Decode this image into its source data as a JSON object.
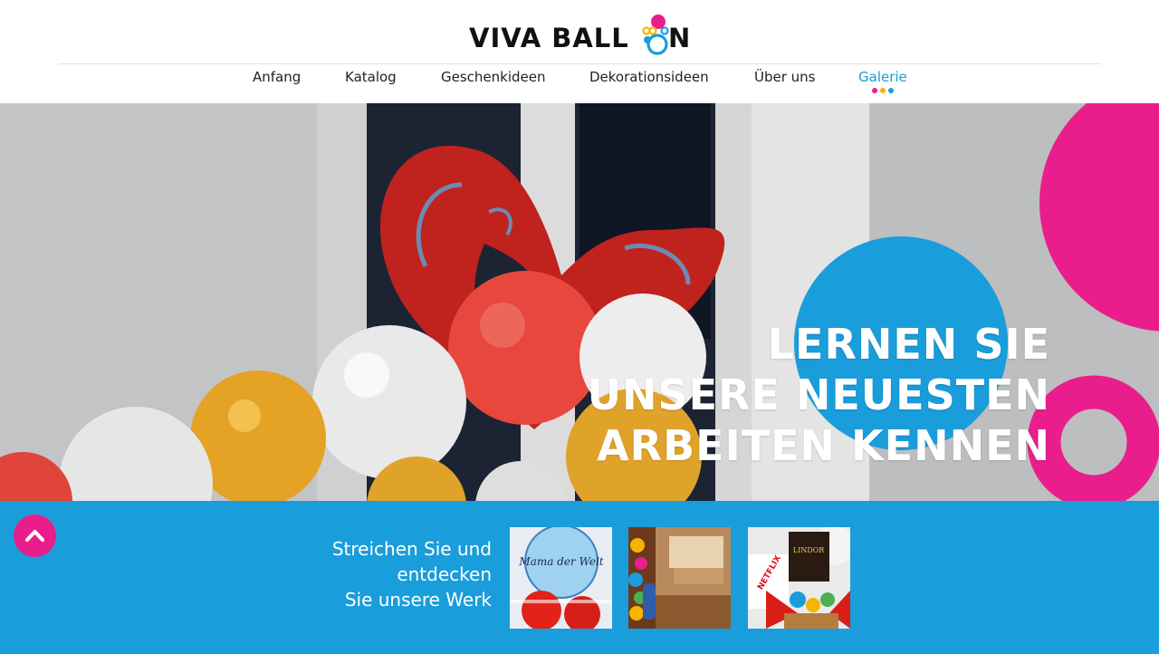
{
  "header": {
    "logo_text": "VIVA BALL",
    "logo_end": "N",
    "logo_alt": "VIVA BALLON"
  },
  "nav": {
    "items": [
      {
        "label": "Anfang"
      },
      {
        "label": "Katalog"
      },
      {
        "label": "Geschenkideen"
      },
      {
        "label": "Dekorationsideen"
      },
      {
        "label": "Über uns"
      },
      {
        "label": "Galerie"
      }
    ],
    "active": "Galerie"
  },
  "hero": {
    "title_lines": [
      "LERNEN SIE",
      "UNSERE NEUESTEN",
      "ARBEITEN KENNEN"
    ]
  },
  "gallery_band": {
    "text_lines": [
      "Streichen Sie und",
      "entdecken",
      "Sie unsere Werk"
    ],
    "thumb1_caption": "Mama der Welt",
    "thumb3_brand1": "NETFLIX",
    "thumb3_brand2": "LINDOR"
  },
  "colors": {
    "brand_blue": "#1a9ddb",
    "brand_pink": "#e91e8c",
    "brand_yellow": "#f7b500",
    "text_dark": "#222222",
    "white": "#ffffff"
  },
  "icons": {
    "scroll_up": "chevron-up-icon"
  }
}
